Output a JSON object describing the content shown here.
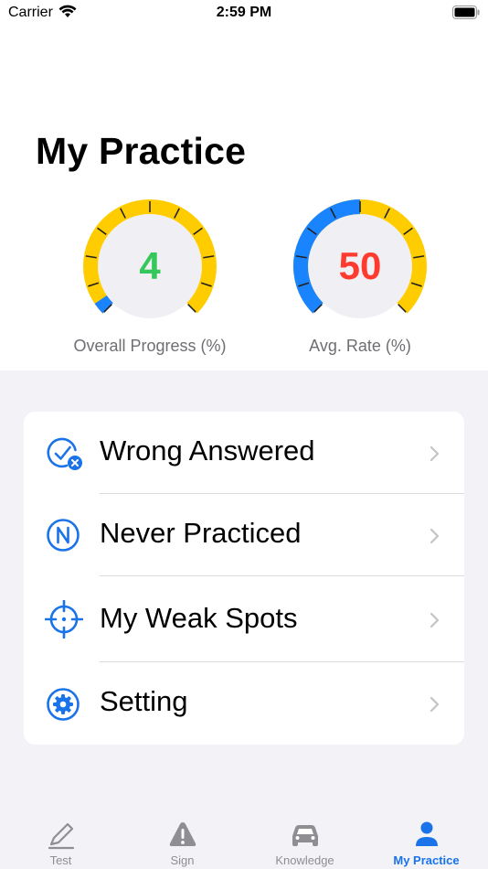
{
  "status_bar": {
    "carrier": "Carrier",
    "time": "2:59 PM"
  },
  "page": {
    "title": "My Practice"
  },
  "gauges": [
    {
      "name": "overall-progress",
      "value": "4",
      "caption": "Overall Progress (%)",
      "value_color": "#34c759",
      "blue_fraction": 0.04
    },
    {
      "name": "avg-rate",
      "value": "50",
      "caption": "Avg. Rate (%)",
      "value_color": "#ff3b30",
      "blue_fraction": 0.5
    }
  ],
  "menu": {
    "items": [
      {
        "label": "Wrong Answered",
        "icon": "wrong-answered-icon"
      },
      {
        "label": "Never Practiced",
        "icon": "never-practiced-icon"
      },
      {
        "label": "My Weak Spots",
        "icon": "crosshair-icon"
      },
      {
        "label": "Setting",
        "icon": "gear-icon"
      }
    ]
  },
  "tab_bar": {
    "tabs": [
      {
        "label": "Test",
        "icon": "pencil-icon",
        "active": false
      },
      {
        "label": "Sign",
        "icon": "warning-icon",
        "active": false
      },
      {
        "label": "Knowledge",
        "icon": "car-icon",
        "active": false
      },
      {
        "label": "My Practice",
        "icon": "person-icon",
        "active": true
      }
    ]
  },
  "colors": {
    "accent": "#1a73e8",
    "gauge_blue": "#1a84ff",
    "gauge_yellow": "#ffcc00",
    "gauge_face": "#efeff4",
    "background": "#f2f2f7"
  }
}
